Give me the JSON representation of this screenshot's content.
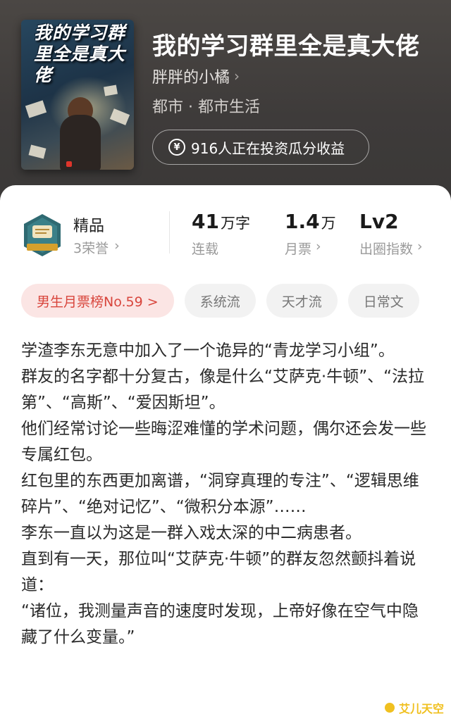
{
  "book": {
    "cover_title": "我的学习群里全是真大佬",
    "cover_author": "",
    "cover_brand": "",
    "title": "我的学习群里全是真大佬",
    "author": "胖胖的小橘",
    "genre": "都市 · 都市生活",
    "invest_text": "916人正在投资瓜分收益"
  },
  "quality": {
    "label": "精品",
    "honors": "3荣誉"
  },
  "stats": {
    "words_value": "41",
    "words_unit": "万字",
    "words_label": "连载",
    "tickets_value": "1.4",
    "tickets_unit": "万",
    "tickets_label": "月票",
    "level_value": "Lv2",
    "level_label": "出圈指数"
  },
  "tags": [
    "男生月票榜No.59 >",
    "系统流",
    "天才流",
    "日常文"
  ],
  "description": [
    "学渣李东无意中加入了一个诡异的“青龙学习小组”。",
    "群友的名字都十分复古，像是什么“艾萨克·牛顿”、“法拉第”、“高斯”、“爱因斯坦”。",
    "他们经常讨论一些晦涩难懂的学术问题，偶尔还会发一些专属红包。",
    "红包里的东西更加离谱，“洞穿真理的专注”、“逻辑思维碎片”、“绝对记忆”、“微积分本源”……",
    "李东一直以为这是一群入戏太深的中二病患者。",
    "直到有一天，那位叫“艾萨克·牛顿”的群友忽然颤抖着说道：",
    "“诸位，我测量声音的速度时发现，上帝好像在空气中隐藏了什么变量。”"
  ],
  "watermark": "艾儿天空",
  "colors": {
    "header_bg": "#3e3b3a",
    "rank_tag_bg": "#fbe5e4",
    "rank_tag_text": "#d8453c",
    "watermark": "#f0c020"
  }
}
